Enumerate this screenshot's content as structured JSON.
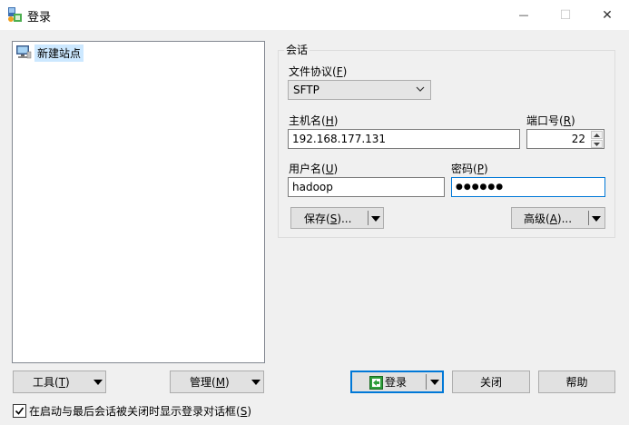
{
  "window": {
    "title": "登录",
    "minimize_glyph": "—",
    "maximize_glyph": "☐",
    "close_glyph": "✕"
  },
  "tree": {
    "items": [
      {
        "label": "新建站点",
        "icon": "computer-icon"
      }
    ]
  },
  "session": {
    "group_title": "会话",
    "protocol_label": "文件协议(F)",
    "protocol_label_main": "文件协议(",
    "protocol_label_key": "F",
    "protocol_label_end": ")",
    "protocol_value": "SFTP",
    "host_label_main": "主机名(",
    "host_label_key": "H",
    "host_label_end": ")",
    "host_value": "192.168.177.131",
    "port_label_main": "端口号(",
    "port_label_key": "R",
    "port_label_end": ")",
    "port_value": "22",
    "user_label_main": "用户名(",
    "user_label_key": "U",
    "user_label_end": ")",
    "user_value": "hadoop",
    "password_label_main": "密码(",
    "password_label_key": "P",
    "password_label_end": ")",
    "password_value": "●●●●●●",
    "save_label_main": "保存(",
    "save_label_key": "S",
    "save_label_end": ")...",
    "advanced_label_main": "高级(",
    "advanced_label_key": "A",
    "advanced_label_end": ")..."
  },
  "bottom": {
    "tools_main": "工具(",
    "tools_key": "T",
    "tools_end": ")",
    "manage_main": "管理(",
    "manage_key": "M",
    "manage_end": ")",
    "login_label": "登录",
    "close_label": "关闭",
    "help_label": "帮助",
    "checkbox_main": "在启动与最后会话被关闭时显示登录对话框(",
    "checkbox_key": "S",
    "checkbox_end": ")",
    "checkbox_checked": true
  },
  "colors": {
    "accent": "#0078d7",
    "selection": "#cce8ff"
  }
}
